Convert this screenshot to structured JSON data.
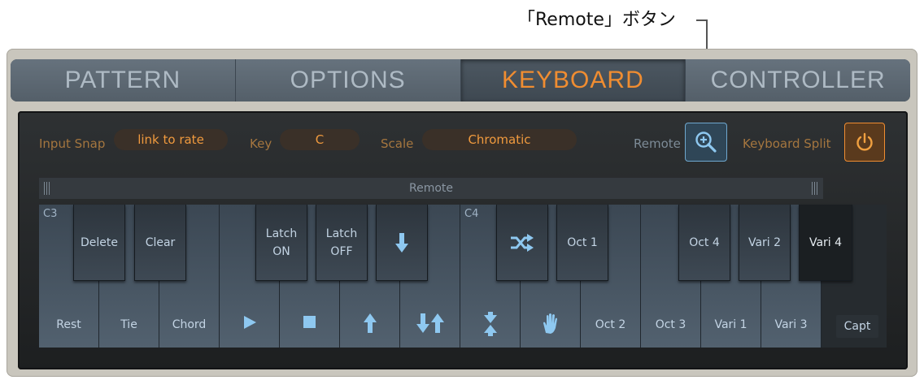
{
  "callout": {
    "text": "「Remote」ボタン"
  },
  "tabs": [
    {
      "label": "PATTERN",
      "active": false
    },
    {
      "label": "OPTIONS",
      "active": false
    },
    {
      "label": "KEYBOARD",
      "active": true
    },
    {
      "label": "CONTROLLER",
      "active": false
    }
  ],
  "controls": {
    "input_snap_label": "Input Snap",
    "input_snap_value": "link to rate",
    "key_label": "Key",
    "key_value": "C",
    "scale_label": "Scale",
    "scale_value": "Chromatic",
    "remote_label": "Remote",
    "remote_icon": "zoom-plus-icon",
    "split_label": "Keyboard Split",
    "split_icon": "power-icon"
  },
  "remote_strip": {
    "label": "Remote"
  },
  "octave_labels": {
    "c3": "C3",
    "c4": "C4"
  },
  "white_keys": [
    {
      "label": "Rest"
    },
    {
      "label": "Tie"
    },
    {
      "label": "Chord"
    },
    {
      "label": "",
      "icon": "play-icon"
    },
    {
      "label": "",
      "icon": "stop-icon"
    },
    {
      "label": "",
      "icon": "arrow-up-icon"
    },
    {
      "label": "",
      "icon": "arrows-down-up-icon"
    },
    {
      "label": "",
      "icon": "arrows-converge-icon"
    },
    {
      "label": "",
      "icon": "hand-icon"
    },
    {
      "label": "Oct 2"
    },
    {
      "label": "Oct 3"
    },
    {
      "label": "Vari 1"
    },
    {
      "label": "Vari 3"
    }
  ],
  "black_keys": {
    "delete": "Delete",
    "clear": "Clear",
    "latch_on_1": "Latch",
    "latch_on_2": "ON",
    "latch_off_1": "Latch",
    "latch_off_2": "OFF",
    "down_icon": "arrow-down-icon",
    "shuffle_icon": "shuffle-icon",
    "oct1": "Oct 1",
    "oct4": "Oct 4",
    "vari2": "Vari 2",
    "vari4": "Vari 4"
  },
  "capt": {
    "label": "Capt"
  }
}
